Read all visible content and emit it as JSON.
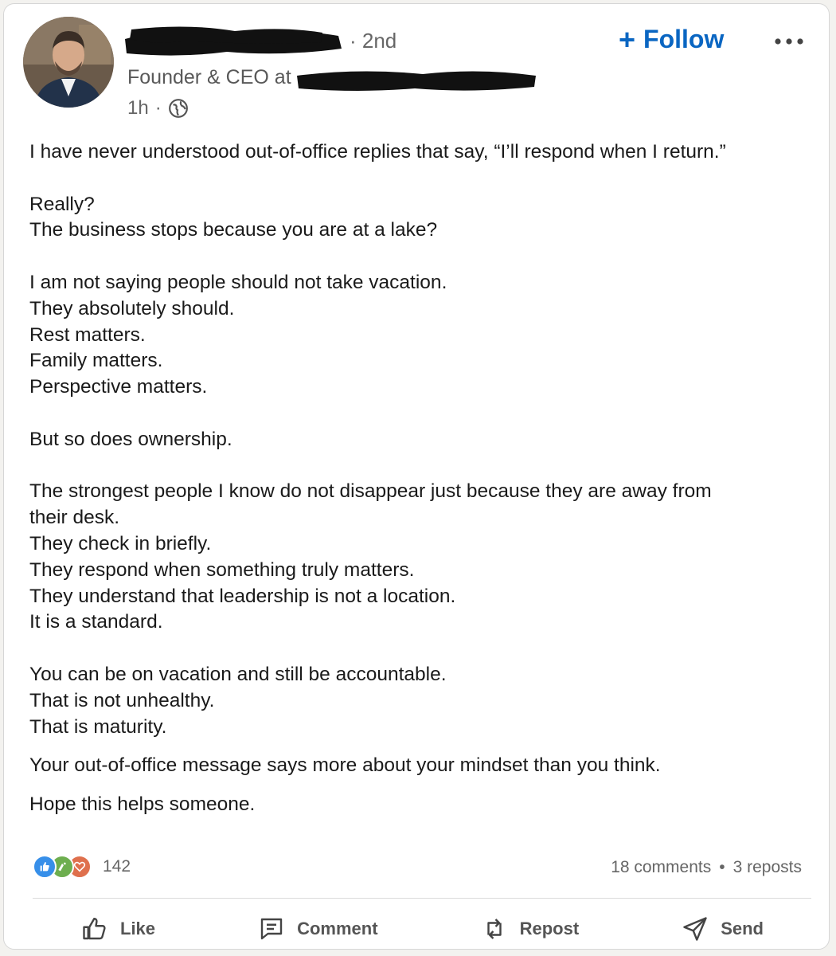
{
  "post": {
    "degree": "· 2nd",
    "headline_prefix": "Founder & CEO at",
    "time": "1h",
    "time_sep": "·",
    "follow_label": "Follow",
    "follow_plus": "+",
    "more_label": "more-options",
    "paragraphs": [
      "I have never understood out-of-office replies that say, “I’ll respond when I return.”",
      "Really?\nThe business stops because you are at a lake?",
      "I am not saying people should not take vacation.\nThey absolutely should.\nRest matters.\nFamily matters.\nPerspective matters.",
      "But so does ownership.",
      "The strongest people I know do not disappear just because they are away from their desk.\nThey check in briefly.\nThey respond when something truly matters.\nThey understand that leadership is not a location.\nIt is a standard.",
      "You can be on vacation and still be accountable.\nThat is not unhealthy.\nThat is maturity.",
      "Your out-of-office message says more about your mindset than you think.",
      "Hope this helps someone."
    ]
  },
  "social": {
    "reaction_count": "142",
    "comments": "18 comments",
    "stat_sep": "•",
    "reposts": "3 reposts"
  },
  "actions": {
    "like": "Like",
    "comment": "Comment",
    "repost": "Repost",
    "send": "Send"
  },
  "colors": {
    "accent": "#0a66c2",
    "like_reaction": "#378fe9",
    "celebrate_reaction": "#6dae4f",
    "love_reaction": "#df704d"
  },
  "icons": {
    "globe": "globe-icon",
    "like": "thumbs-up-icon",
    "comment": "comment-icon",
    "repost": "repost-icon",
    "send": "send-icon"
  }
}
